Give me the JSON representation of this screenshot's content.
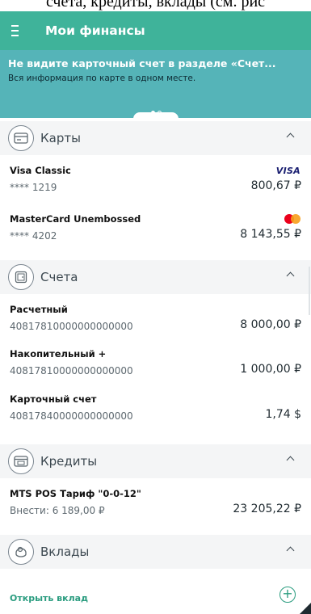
{
  "caption": "счета, кредиты, вклады (см. рис",
  "header": {
    "title": "Мои финансы"
  },
  "banner": {
    "title": "Не видите карточный счет в разделе «Счет...",
    "subtitle": "Вся информация по карте в одном месте."
  },
  "sections": {
    "cards": {
      "label": "Карты",
      "items": [
        {
          "name": "Visa Classic",
          "number": "**** 1219",
          "amount": "800,67 ₽",
          "brand": "VISA"
        },
        {
          "name": "MasterCard Unembossed",
          "number": "**** 4202",
          "amount": "8 143,55 ₽"
        }
      ]
    },
    "accounts": {
      "label": "Счета",
      "items": [
        {
          "name": "Расчетный",
          "number": "40817810000000000000",
          "amount": "8 000,00 ₽"
        },
        {
          "name": "Накопительный +",
          "number": "40817810000000000000",
          "amount": "1 000,00 ₽"
        },
        {
          "name": "Карточный счет",
          "number": "40817840000000000000",
          "amount": "1,74 $"
        }
      ]
    },
    "credits": {
      "label": "Кредиты",
      "items": [
        {
          "name": "MTS POS  Тариф \"0-0-12\"",
          "sub": "Внести: 6 189,00 ₽",
          "amount": "23 205,22 ₽"
        }
      ]
    },
    "deposits": {
      "label": "Вклады",
      "open_label": "Открыть вклад",
      "plus": "+"
    }
  },
  "colors": {
    "header": "#3fb39a",
    "banner": "#55b4b8",
    "accent": "#2a9c7f"
  }
}
